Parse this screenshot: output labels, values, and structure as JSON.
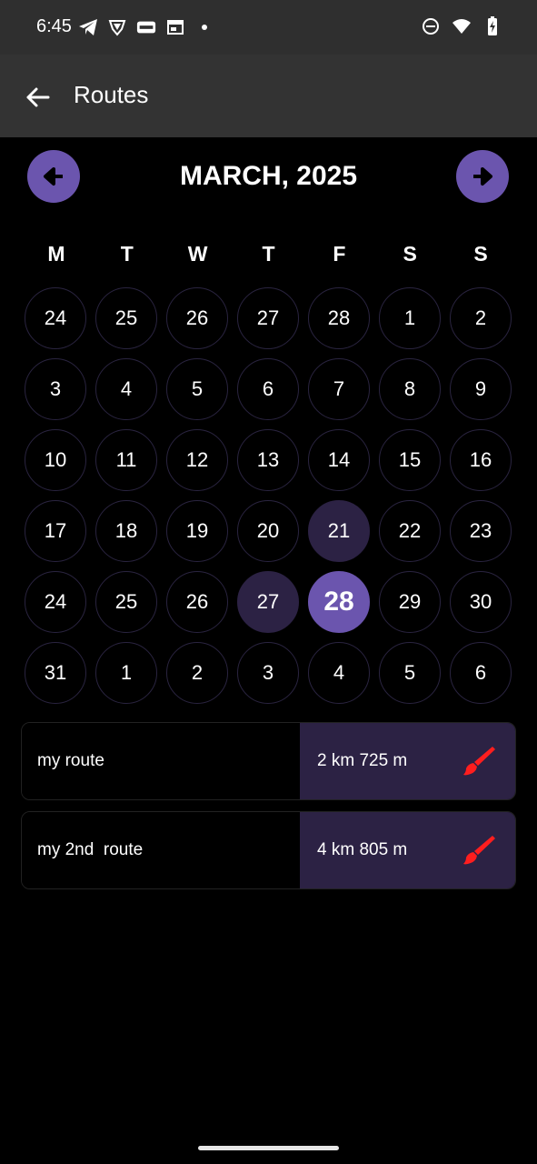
{
  "status_bar": {
    "time": "6:45",
    "left_icons": [
      "telegram-icon",
      "vpn-shield-icon",
      "compy-icon",
      "calendar-icon",
      "dot-icon"
    ],
    "right_icons": [
      "do-not-disturb-icon",
      "wifi-icon",
      "battery-icon"
    ]
  },
  "app_bar": {
    "title": "Routes",
    "back_icon": "arrow-left-icon"
  },
  "calendar": {
    "month_label": "MARCH, 2025",
    "weekdays": [
      "M",
      "T",
      "W",
      "T",
      "F",
      "S",
      "S"
    ],
    "weeks": [
      [
        "24",
        "25",
        "26",
        "27",
        "28",
        "1",
        "2"
      ],
      [
        "3",
        "4",
        "5",
        "6",
        "7",
        "8",
        "9"
      ],
      [
        "10",
        "11",
        "12",
        "13",
        "14",
        "15",
        "16"
      ],
      [
        "17",
        "18",
        "19",
        "20",
        "21",
        "22",
        "23"
      ],
      [
        "24",
        "25",
        "26",
        "27",
        "28",
        "29",
        "30"
      ],
      [
        "31",
        "1",
        "2",
        "3",
        "4",
        "5",
        "6"
      ]
    ],
    "selected_day": "28",
    "highlighted_days": [
      "21",
      "27"
    ],
    "colors": {
      "accent": "#6b55ae",
      "range": "#2c2244"
    }
  },
  "routes": [
    {
      "name": "my route",
      "distance": "2 km 725 m",
      "icon": "paint-brush-icon"
    },
    {
      "name": "my 2nd  route",
      "distance": "4 km 805 m",
      "icon": "paint-brush-icon"
    }
  ]
}
